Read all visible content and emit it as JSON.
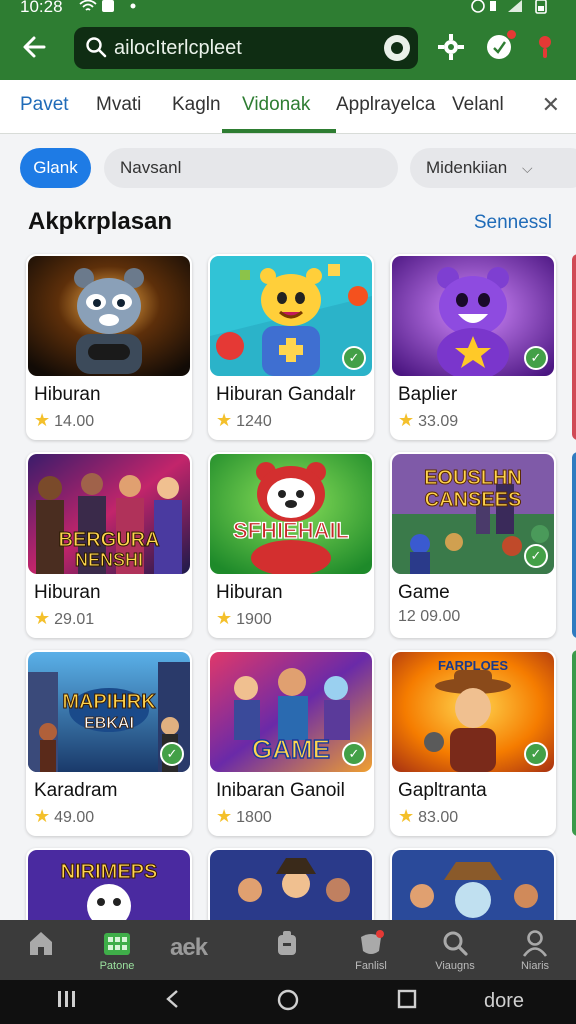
{
  "status_bar": {
    "time": "10:28"
  },
  "header": {
    "search_query": "ailocIterlcpleet",
    "icons": [
      "back-arrow-icon",
      "search-icon",
      "lens-icon",
      "settings-gear-icon",
      "shield-notify-icon",
      "location-pin-icon"
    ]
  },
  "tabs": [
    {
      "label": "Pavet",
      "active": false
    },
    {
      "label": "Mvati",
      "active": false
    },
    {
      "label": "Kagln",
      "active": false
    },
    {
      "label": "Vidonak",
      "active": true
    },
    {
      "label": "Applrayelca",
      "active": false
    },
    {
      "label": "Velanl",
      "active": false
    }
  ],
  "filters": {
    "primary": "Glank",
    "secondary": "Navsanl",
    "dropdown": "Midenkiian"
  },
  "section": {
    "title": "Akpkrplasan",
    "link": "Sennessl"
  },
  "cards": [
    {
      "title": "Hiburan",
      "rating": "14.00",
      "star": true,
      "verified": false
    },
    {
      "title": "Hiburan Gandalr",
      "rating": "1240",
      "star": true,
      "verified": true
    },
    {
      "title": "Baplier",
      "rating": "33.09",
      "star": true,
      "verified": true
    },
    {
      "title": "Hiburan",
      "rating": "29.01",
      "star": true,
      "verified": false,
      "art_text": [
        "BERGURA",
        "NENSHI"
      ]
    },
    {
      "title": "Hiburan",
      "rating": "1900",
      "star": true,
      "verified": false,
      "art_text": [
        "SFHIEHAIL"
      ]
    },
    {
      "title": "Game",
      "rating": "12 09.00",
      "star": false,
      "verified": true,
      "art_text": [
        "EOUSLHN",
        "CANSEES"
      ]
    },
    {
      "title": "Karadram",
      "rating": "49.00",
      "star": true,
      "verified": true,
      "art_text": [
        "MAPIHRK",
        "EBKAI"
      ]
    },
    {
      "title": "Inibaran Ganoil",
      "rating": "1800",
      "star": true,
      "verified": true,
      "art_text": [
        "GAME"
      ]
    },
    {
      "title": "Gapltranta",
      "rating": "83.00",
      "star": true,
      "verified": true,
      "art_text": [
        "FARPLOES"
      ]
    },
    {
      "title": "",
      "rating": "",
      "star": false,
      "verified": false,
      "art_text": [
        "NIRIMEPS"
      ]
    },
    {
      "title": "",
      "rating": "",
      "star": false,
      "verified": false
    },
    {
      "title": "",
      "rating": "",
      "star": false,
      "verified": false
    }
  ],
  "bottom_nav": {
    "items": [
      {
        "label": "",
        "icon": "home-icon"
      },
      {
        "label": "Patone",
        "icon": "apps-grid-icon",
        "active": true
      },
      {
        "label": "",
        "icon": ""
      },
      {
        "label": "",
        "icon": "bag-icon"
      },
      {
        "label": "Fanlisl",
        "icon": "notification-badge-icon"
      },
      {
        "label": "Viaugns",
        "icon": "search-icon"
      },
      {
        "label": "Niaris",
        "icon": "person-icon"
      }
    ],
    "text_item": "aek"
  },
  "system_nav": {
    "done": "dore"
  },
  "colors": {
    "header_green": "#2e7d32",
    "accent_blue": "#1e7be5",
    "link_blue": "#1f6bb8",
    "star_gold": "#f4c02b",
    "check_green": "#43a047"
  }
}
